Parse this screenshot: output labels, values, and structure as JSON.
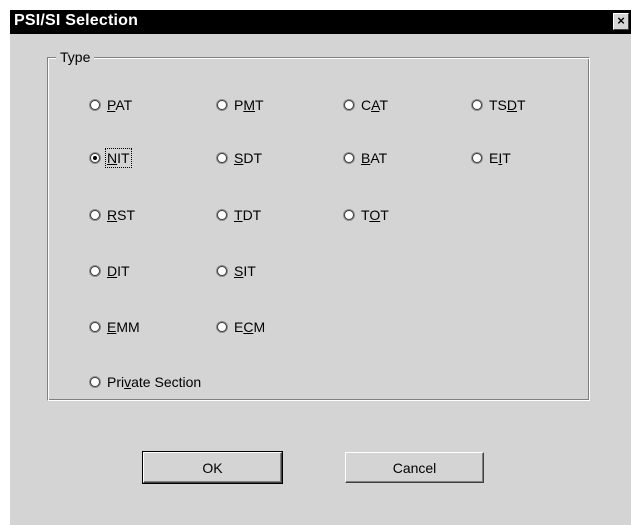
{
  "window": {
    "title": "PSI/SI Selection",
    "close_glyph": "×"
  },
  "group": {
    "legend": "Type"
  },
  "radios": [
    {
      "pre": "",
      "u": "P",
      "post": "AT",
      "checked": false
    },
    {
      "pre": "P",
      "u": "M",
      "post": "T",
      "checked": false
    },
    {
      "pre": "C",
      "u": "A",
      "post": "T",
      "checked": false
    },
    {
      "pre": "TS",
      "u": "D",
      "post": "T",
      "checked": false
    },
    {
      "pre": "",
      "u": "N",
      "post": "IT",
      "checked": true
    },
    {
      "pre": "",
      "u": "S",
      "post": "DT",
      "checked": false
    },
    {
      "pre": "",
      "u": "B",
      "post": "AT",
      "checked": false
    },
    {
      "pre": "E",
      "u": "I",
      "post": "T",
      "checked": false
    },
    {
      "pre": "",
      "u": "R",
      "post": "ST",
      "checked": false
    },
    {
      "pre": "",
      "u": "T",
      "post": "DT",
      "checked": false
    },
    {
      "pre": "T",
      "u": "O",
      "post": "T",
      "checked": false
    },
    {
      "pre": "",
      "u": "D",
      "post": "IT",
      "checked": false
    },
    {
      "pre": "",
      "u": "S",
      "post": "IT",
      "checked": false
    },
    {
      "pre": "",
      "u": "E",
      "post": "MM",
      "checked": false
    },
    {
      "pre": "E",
      "u": "C",
      "post": "M",
      "checked": false
    },
    {
      "pre": "Pri",
      "u": "v",
      "post": "ate Section",
      "checked": false
    }
  ],
  "buttons": {
    "ok": "OK",
    "cancel": "Cancel"
  }
}
